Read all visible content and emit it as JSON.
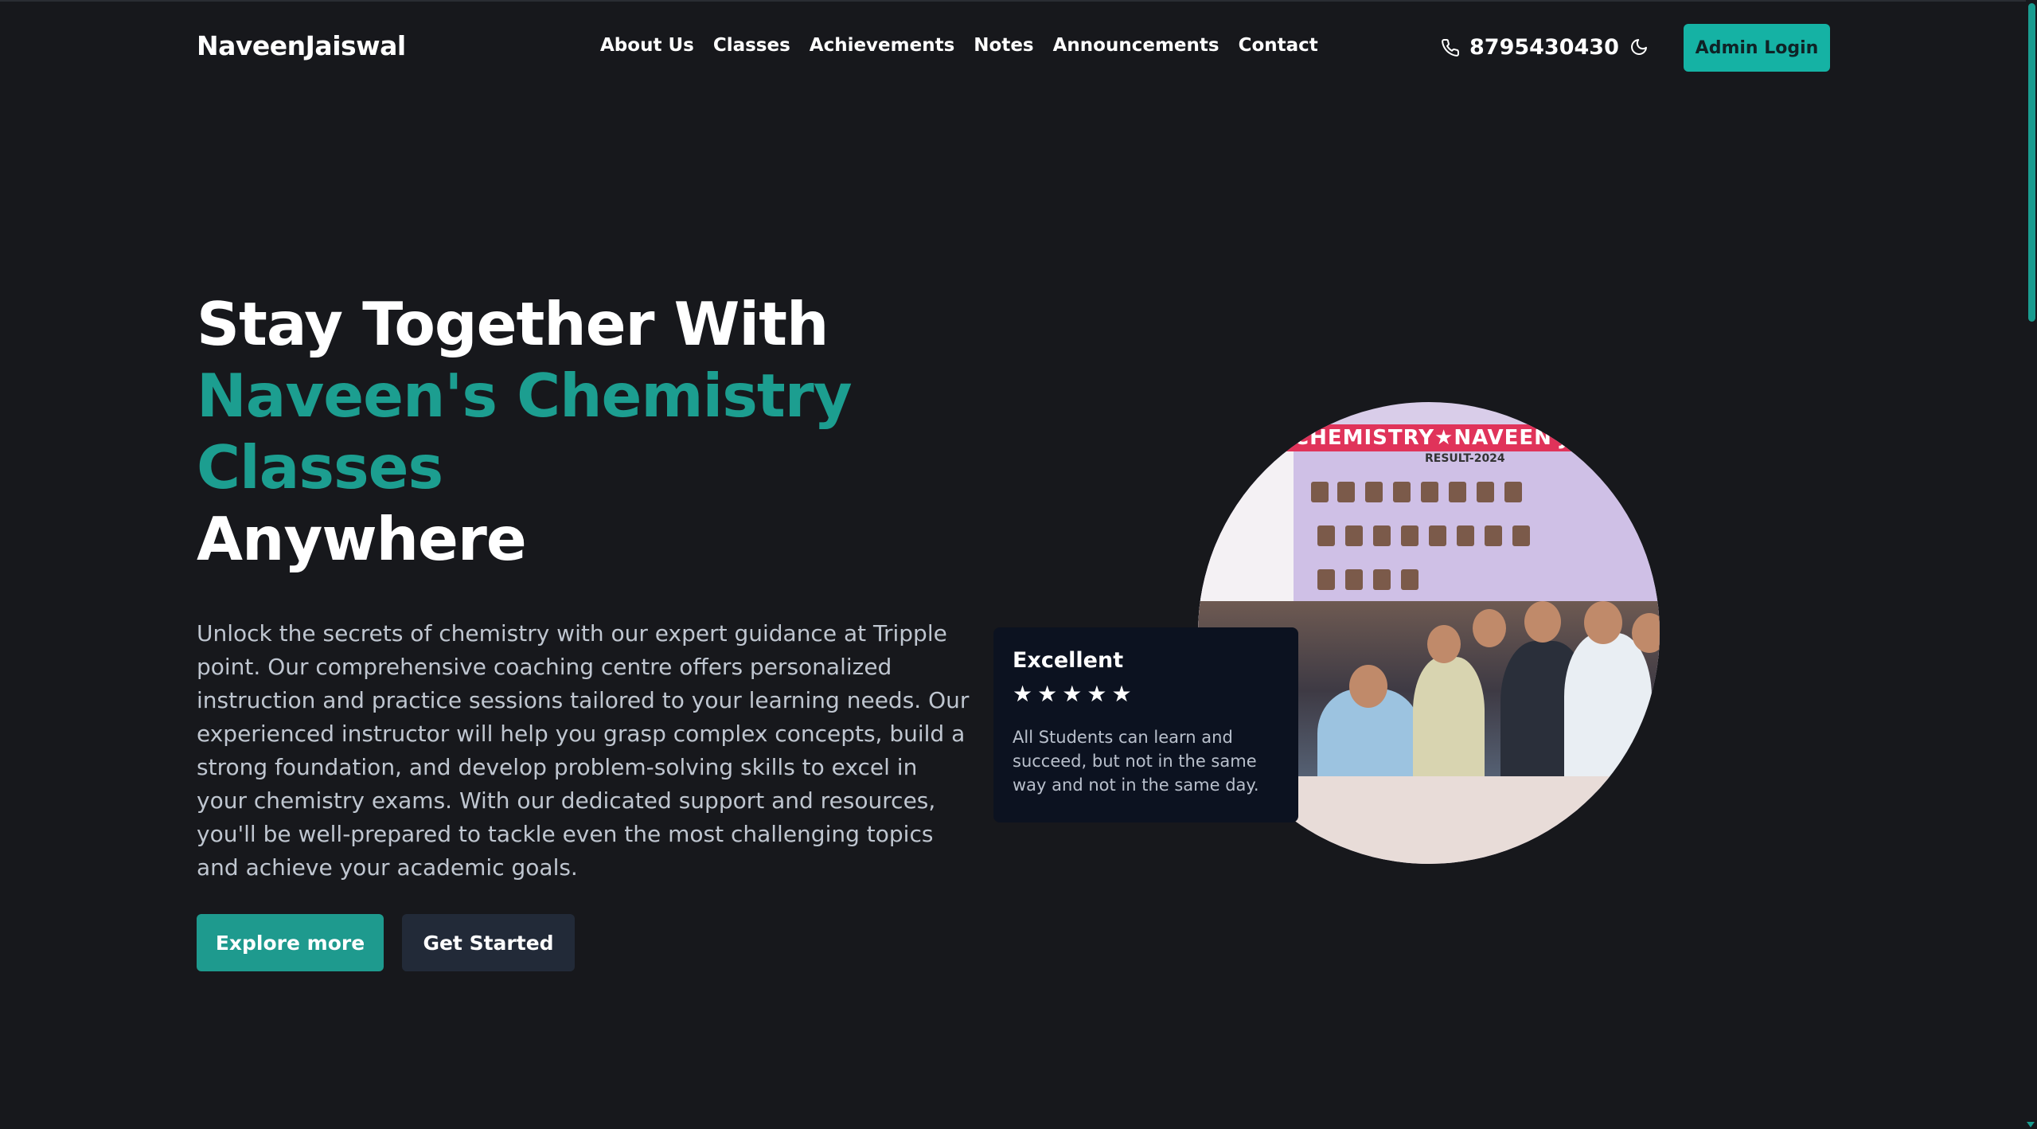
{
  "header": {
    "brand": "NaveenJaiswal",
    "nav": [
      "About Us",
      "Classes",
      "Achievements",
      "Notes",
      "Announcements",
      "Contact"
    ],
    "phone": "8795430430",
    "admin_label": "Admin Login"
  },
  "hero": {
    "line1": "Stay Together With",
    "line2": "Naveen's Chemistry",
    "line3": "Classes",
    "line4": "Anywhere",
    "description": "Unlock the secrets of chemistry with our expert guidance at Tripple point. Our comprehensive coaching centre offers personalized instruction and practice sessions tailored to your learning needs. Our experienced instructor will help you grasp complex concepts, build a strong foundation, and develop problem-solving skills to excel in your chemistry exams. With our dedicated support and resources, you'll be well-prepared to tackle even the most challenging topics and achieve your academic goals.",
    "explore_label": "Explore more",
    "start_label": "Get Started"
  },
  "photo": {
    "banner": "CHEMISTRY★NAVEEN JAI",
    "result": "RESULT-2024"
  },
  "review": {
    "title": "Excellent",
    "rating": 5,
    "text": "All Students can learn and succeed, but not in the same way and not in the same day."
  },
  "colors": {
    "background": "#17181c",
    "accent": "#15b2a4",
    "heading_accent": "#1c9e90",
    "card": "#0c1220"
  },
  "icons": [
    "phone-icon",
    "moon-icon",
    "star-icon"
  ]
}
